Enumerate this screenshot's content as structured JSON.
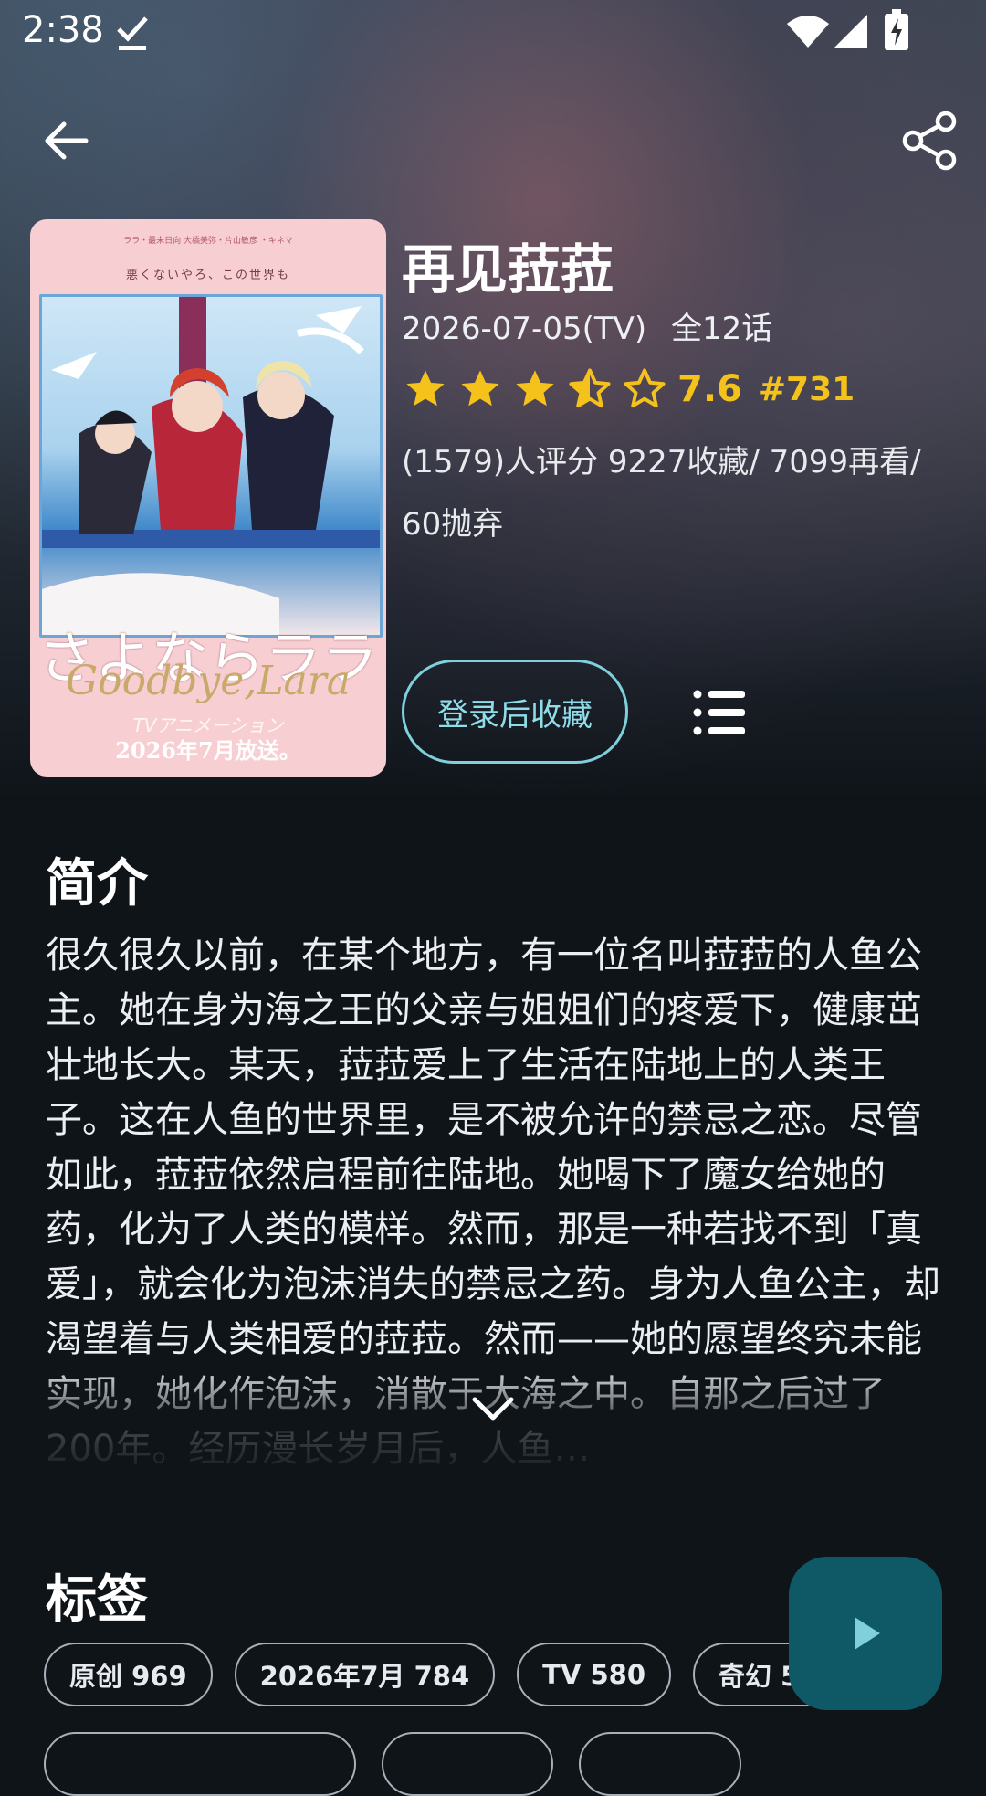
{
  "status_bar": {
    "time": "2:38"
  },
  "poster": {
    "tagline": "悪くないやろ、この世界も",
    "top_credits": "ララ・最未日向 大橋美弥・片山敏彦 ・キネマ",
    "title_jp": "さよならララ",
    "title_en": "Goodbye,Lara",
    "sub": "TVアニメーション",
    "date": "2026年7月放送。"
  },
  "anime": {
    "title": "再见菈菈",
    "air_date": "2026-07-05(TV)",
    "episodes": "全12话",
    "rating": 3.5,
    "score": "7.6",
    "rank": "#731",
    "stats_line1": "(1579)人评分  9227收藏/  7099再看/",
    "stats_line2": "60抛弃"
  },
  "actions": {
    "collect_label": "登录后收藏"
  },
  "intro": {
    "heading": "简介",
    "text": "很久很久以前，在某个地方，有一位名叫菈菈的人鱼公主。她在身为海之王的父亲与姐姐们的疼爱下，健康茁壮地长大。某天，菈菈爱上了生活在陆地上的人类王子。这在人鱼的世界里，是不被允许的禁忌之恋。尽管如此，菈菈依然启程前往陆地。她喝下了魔女给她的药，化为了人类的模样。然而，那是一种若找不到「真爱」，就会化为泡沫消失的禁忌之药。身为人鱼公主，却渴望着与人类相爱的菈菈。然而——她的愿望终究未能实现，她化作泡沫，消散于大海之中。自那之后过了200年。经历漫长岁月后，人鱼…"
  },
  "tags": {
    "heading": "标签",
    "items": [
      {
        "label": "原创 969"
      },
      {
        "label": "2026年7月 784"
      },
      {
        "label": "TV 580"
      },
      {
        "label": "奇幻 55"
      }
    ]
  },
  "colors": {
    "accent_star": "#f5c21b",
    "collect_outline": "#7fd0dc",
    "fab_bg": "#0e5965",
    "fab_icon": "#7fd0dc"
  },
  "icons": [
    "back-arrow-icon",
    "share-icon",
    "star-icon",
    "half-star-icon",
    "star-outline-icon",
    "list-icon",
    "chevron-down-icon",
    "play-icon",
    "wifi-icon",
    "signal-icon",
    "battery-icon",
    "download-done-icon"
  ]
}
